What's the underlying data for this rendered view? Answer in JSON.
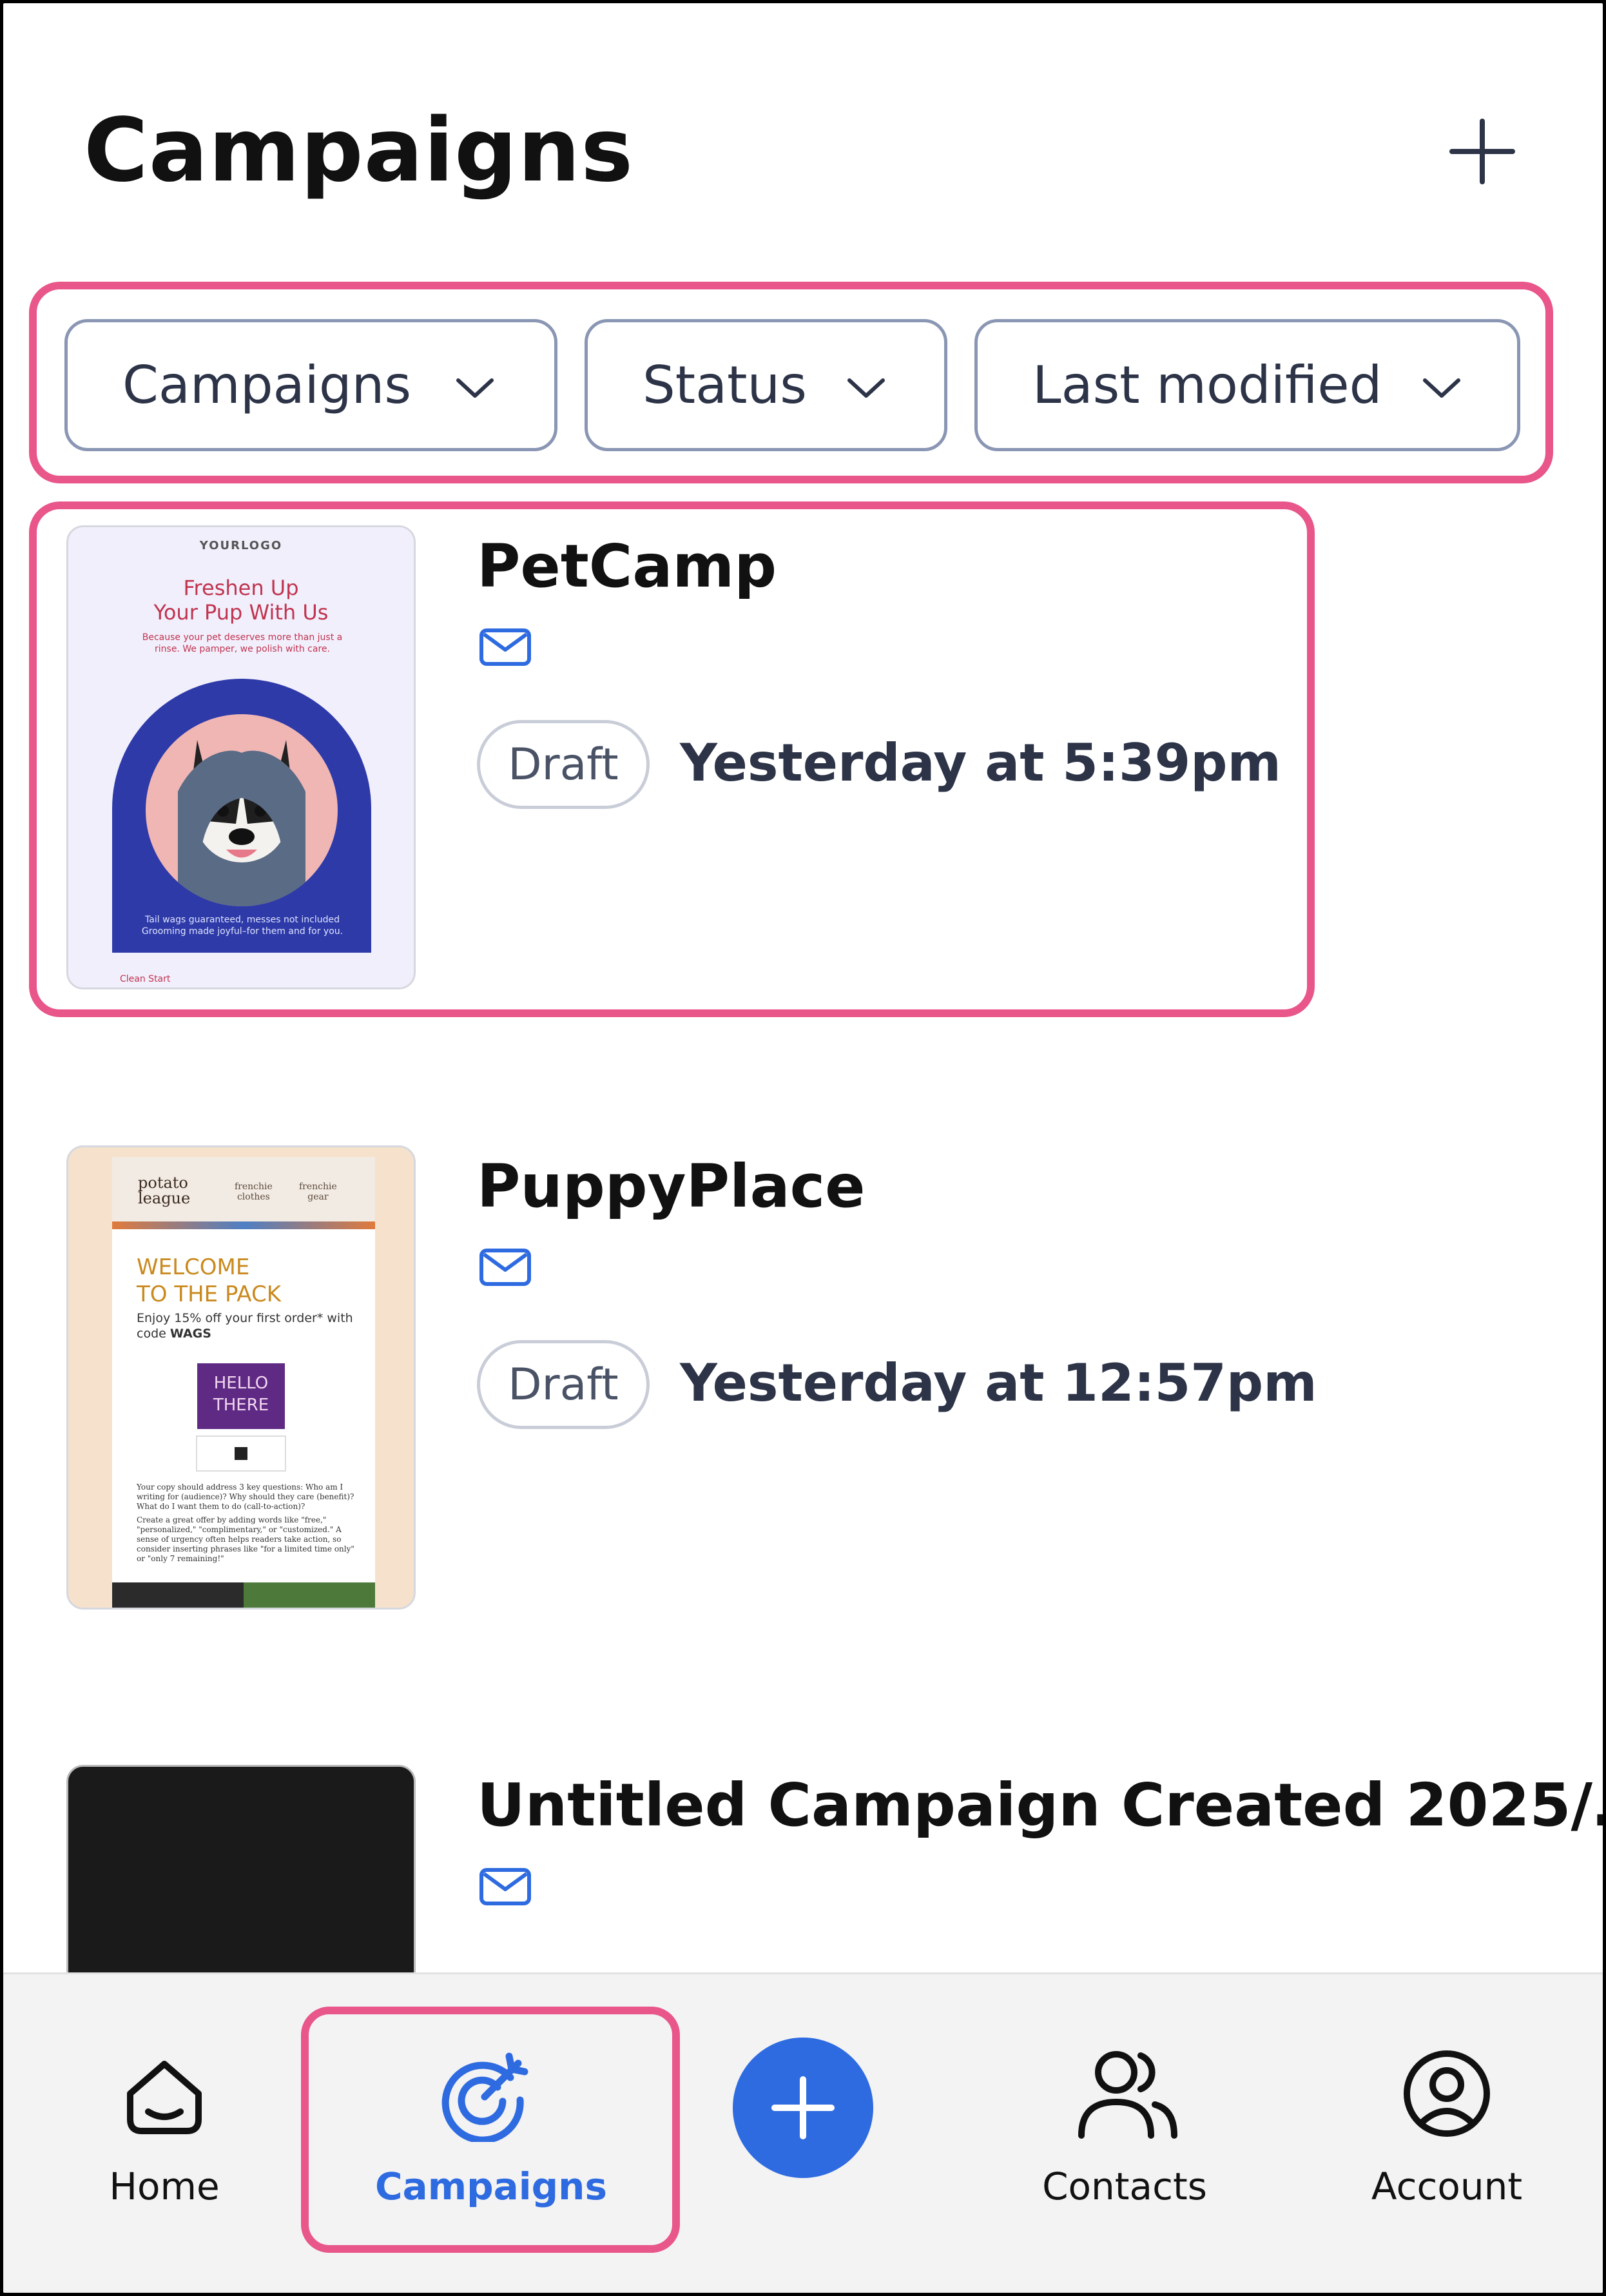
{
  "header": {
    "title": "Campaigns"
  },
  "filters": [
    {
      "label": "Campaigns"
    },
    {
      "label": "Status"
    },
    {
      "label": "Last modified"
    }
  ],
  "campaigns": [
    {
      "name": "PetCamp",
      "status": "Draft",
      "modified": "Yesterday at 5:39pm",
      "thumbnail": {
        "logo": "YOURLOGO",
        "headline_1": "Freshen Up",
        "headline_2": "Your Pup With Us",
        "sub_1": "Because your pet deserves more than just a",
        "sub_2": "rinse. We pamper, we polish with care.",
        "foot_1": "Tail wags guaranteed, messes not included",
        "foot_2": "Grooming made joyful–for them and for you.",
        "cta": "Clean Start"
      }
    },
    {
      "name": "PuppyPlace",
      "status": "Draft",
      "modified": "Yesterday at 12:57pm",
      "thumbnail": {
        "logo_1": "potato",
        "logo_2": "league",
        "nav_1a": "frenchie",
        "nav_1b": "clothes",
        "nav_2a": "frenchie",
        "nav_2b": "gear",
        "welcome_1": "WELCOME",
        "welcome_2": "TO THE PACK",
        "offer": "Enjoy 15% off your first order* with code",
        "code": "WAGS",
        "hello_1": "HELLO",
        "hello_2": "THERE",
        "copy_1": "Your copy should address 3 key questions: Who am I writing for (audience)? Why should they care (benefit)? What do I want them to do (call-to-action)?",
        "copy_2": "Create a great offer by adding words like \"free,\" \"personalized,\" \"complimentary,\" or \"customized.\" A sense of urgency often helps readers take action, so consider inserting phrases like \"for a limited time only\" or \"only 7 remaining!\""
      }
    },
    {
      "name": "Untitled Campaign Created 2025/…"
    }
  ],
  "bottom_nav": {
    "home": "Home",
    "campaigns": "Campaigns",
    "contacts": "Contacts",
    "account": "Account"
  },
  "colors": {
    "accent_blue": "#2f6be0",
    "highlight_pink": "#e8568a",
    "active_nav": "#2f6be0"
  }
}
